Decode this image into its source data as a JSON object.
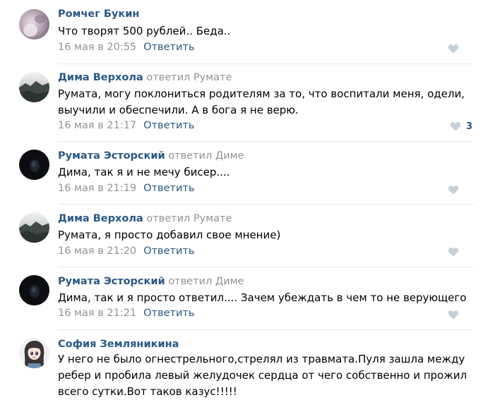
{
  "colors": {
    "author": "#2a5885",
    "muted": "#939393",
    "divider": "#e7e8ec",
    "like_icon": "#c5d0db"
  },
  "comments": [
    {
      "author": "Ромчег Букин",
      "reply_word": "",
      "reply_to": "",
      "text": "Что творят 500 рублей.. Беда..",
      "date": "16 мая в 20:55",
      "reply_label": "Ответить",
      "likes": "",
      "avatar": "avatar-photo"
    },
    {
      "author": "Дима Верхола",
      "reply_word": "ответил",
      "reply_to": "Румате",
      "text": "Румата, могу поклониться родителям за то, что воспитали меня, одели,\nвыучили и обеспечили. А в бога я не верю.",
      "date": "16 мая в 21:17",
      "reply_label": "Ответить",
      "likes": "3",
      "avatar": "avatar-landscape"
    },
    {
      "author": "Румата Эсторский",
      "reply_word": "ответил",
      "reply_to": "Диме",
      "text": "Дима, так я и не мечу бисер....",
      "date": "16 мая в 21:19",
      "reply_label": "Ответить",
      "likes": "",
      "avatar": "avatar-dark"
    },
    {
      "author": "Дима Верхола",
      "reply_word": "ответил",
      "reply_to": "Румате",
      "text": "Румата, я просто добавил свое мнение)",
      "date": "16 мая в 21:20",
      "reply_label": "Ответить",
      "likes": "",
      "avatar": "avatar-landscape"
    },
    {
      "author": "Румата Эсторский",
      "reply_word": "ответил",
      "reply_to": "Диме",
      "text": "Дима, так и я просто ответил.... Зачем убеждать в чем то не верующего",
      "date": "16 мая в 21:21",
      "reply_label": "Ответить",
      "likes": "",
      "avatar": "avatar-dark"
    },
    {
      "author": "София Земляникина",
      "reply_word": "",
      "reply_to": "",
      "text": "У него не было огнестрельного,стрелял из травмата.Пуля зашла между\nребер и пробила левый желудочек сердца от чего собственно и прожил\nвсего сутки.Вот таков казус!!!!!",
      "date": "",
      "reply_label": "",
      "likes": "",
      "avatar": "avatar-cartoon"
    }
  ]
}
